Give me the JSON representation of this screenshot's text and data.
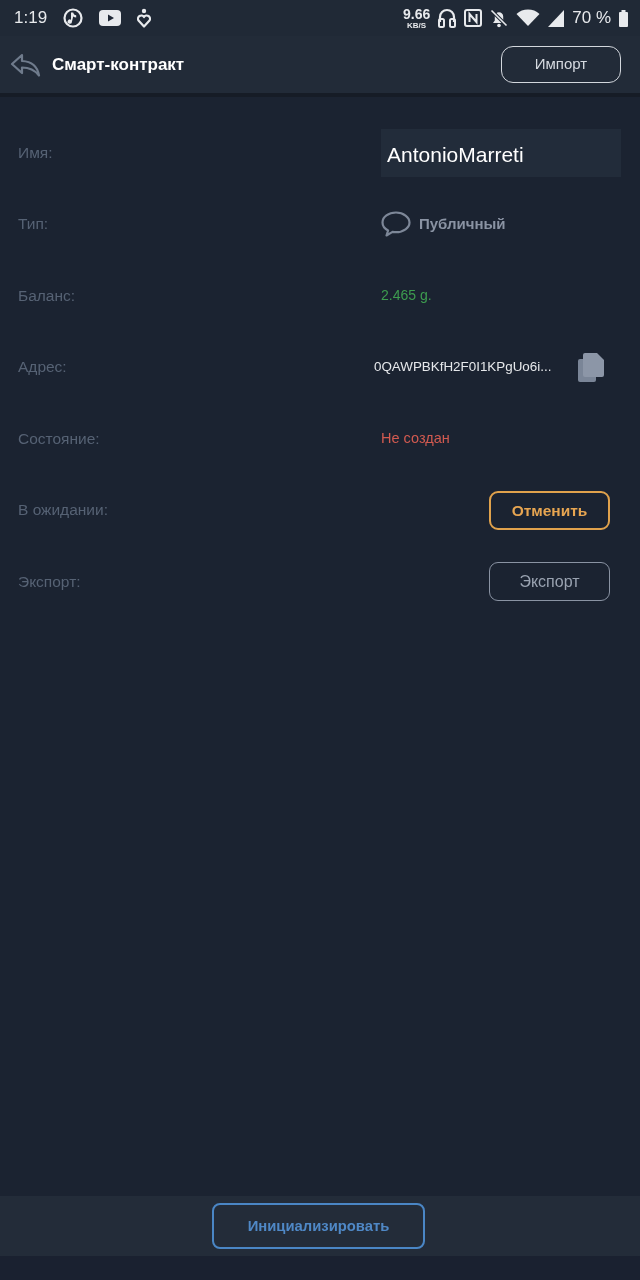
{
  "status_bar": {
    "time": "1:19",
    "speed": "9.66",
    "speed_unit": "KB/S",
    "battery": "70 %"
  },
  "header": {
    "title": "Смарт-контракт",
    "action": "Импорт"
  },
  "fields": [
    {
      "kind": "input",
      "label": "Имя:",
      "value": "AntonioMarreti"
    },
    {
      "kind": "type",
      "label": "Тип:",
      "value": "Публичный"
    },
    {
      "kind": "amount",
      "label": "Баланс:",
      "value": "2.465 g."
    },
    {
      "kind": "address",
      "label": "Адрес:",
      "value": "0QAWPBKfH2F0I1KPgUo6i..."
    },
    {
      "kind": "status",
      "label": "Состояние:",
      "value": "Не создан"
    },
    {
      "kind": "cancel",
      "label": "В ожидании:",
      "value": "Отменить"
    },
    {
      "kind": "export",
      "label": "Экспорт:",
      "value": "Экспорт"
    }
  ],
  "footer": {
    "button": "Инициализировать"
  }
}
